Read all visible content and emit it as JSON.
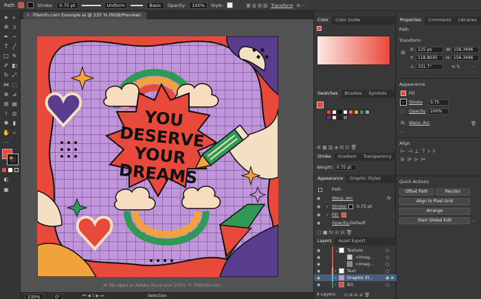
{
  "control_bar": {
    "selection_type": "Path",
    "stroke_label": "Stroke:",
    "stroke_weight": "0.75 pt",
    "stroke_profile": "Uniform",
    "brush": "Basic",
    "opacity_label": "Opacity:",
    "opacity_value": "100%",
    "style_label": "Style:",
    "transform_label": "Transform"
  },
  "document": {
    "tab_title": "FileInfo.com Example.ai @ 235 % (RGB/Preview)",
    "zoom": "235%",
    "rotation": "0°",
    "status_tool": "Selection",
    "watermark": "AI file open in Adobe Illustrator 2023. © FileInfo.com"
  },
  "artwork": {
    "line1": "YOU",
    "line2": "DESERVE",
    "line3": "YOUR",
    "line4": "DREAMS"
  },
  "color_panel": {
    "tabs": [
      "Color",
      "Color Guide"
    ],
    "gradient_start": "#fde9e6",
    "gradient_end": "#e8493a"
  },
  "swatches_panel": {
    "tabs": [
      "Swatches",
      "Brushes",
      "Symbols"
    ],
    "colors": [
      "#e8493a",
      "#f7f7f7",
      "#111111",
      "#ffffff",
      "#e96b52",
      "#f2a23a",
      "#2e9a55",
      "#b88fd0",
      "#5a3d8f",
      "#f3dfc4",
      "#222222",
      "#777777"
    ]
  },
  "stroke_panel": {
    "tabs": [
      "Stroke",
      "Gradient",
      "Transparency"
    ],
    "weight_label": "Weight:",
    "weight_value": "0.75 pt"
  },
  "appearance_panel": {
    "tabs": [
      "Appearance",
      "Graphic Styles"
    ],
    "object_label": "Path",
    "warp": "Warp: Arc",
    "stroke_label": "Stroke:",
    "stroke_value": "0.75 pt",
    "fill_label": "Fill:",
    "opacity_label": "Opacity:",
    "opacity_value": "Default",
    "fx": "fx"
  },
  "layers_panel": {
    "tabs": [
      "Layers",
      "Asset Export"
    ],
    "rows": [
      {
        "name": "Texture"
      },
      {
        "name": "<Imag..."
      },
      {
        "name": "<Imag..."
      },
      {
        "name": "Text"
      },
      {
        "name": "Graphic El..."
      },
      {
        "name": "BG"
      }
    ],
    "count": "4 Layers"
  },
  "properties_panel": {
    "tabs": [
      "Properties",
      "Comments",
      "Libraries"
    ],
    "selection": "Path",
    "transform_title": "Transform",
    "x_label": "X:",
    "x_value": "125 px",
    "w_label": "W:",
    "w_value": "156.3496",
    "y_label": "Y:",
    "y_value": "118.8035",
    "h_label": "H:",
    "h_value": "156.3496",
    "angle_value": "331.7°",
    "appearance_title": "Appearance",
    "fill_label": "Fill",
    "stroke_label": "Stroke",
    "stroke_value": "0.75",
    "opacity_label": "Opacity",
    "opacity_value": "100%",
    "fx_label": "Warp: Arc",
    "align_title": "Align",
    "quick_actions_title": "Quick Actions",
    "offset_path": "Offset Path",
    "recolor": "Recolor",
    "align_pixel_grid": "Align to Pixel Grid",
    "arrange": "Arrange",
    "start_global_edit": "Start Global Edit"
  }
}
